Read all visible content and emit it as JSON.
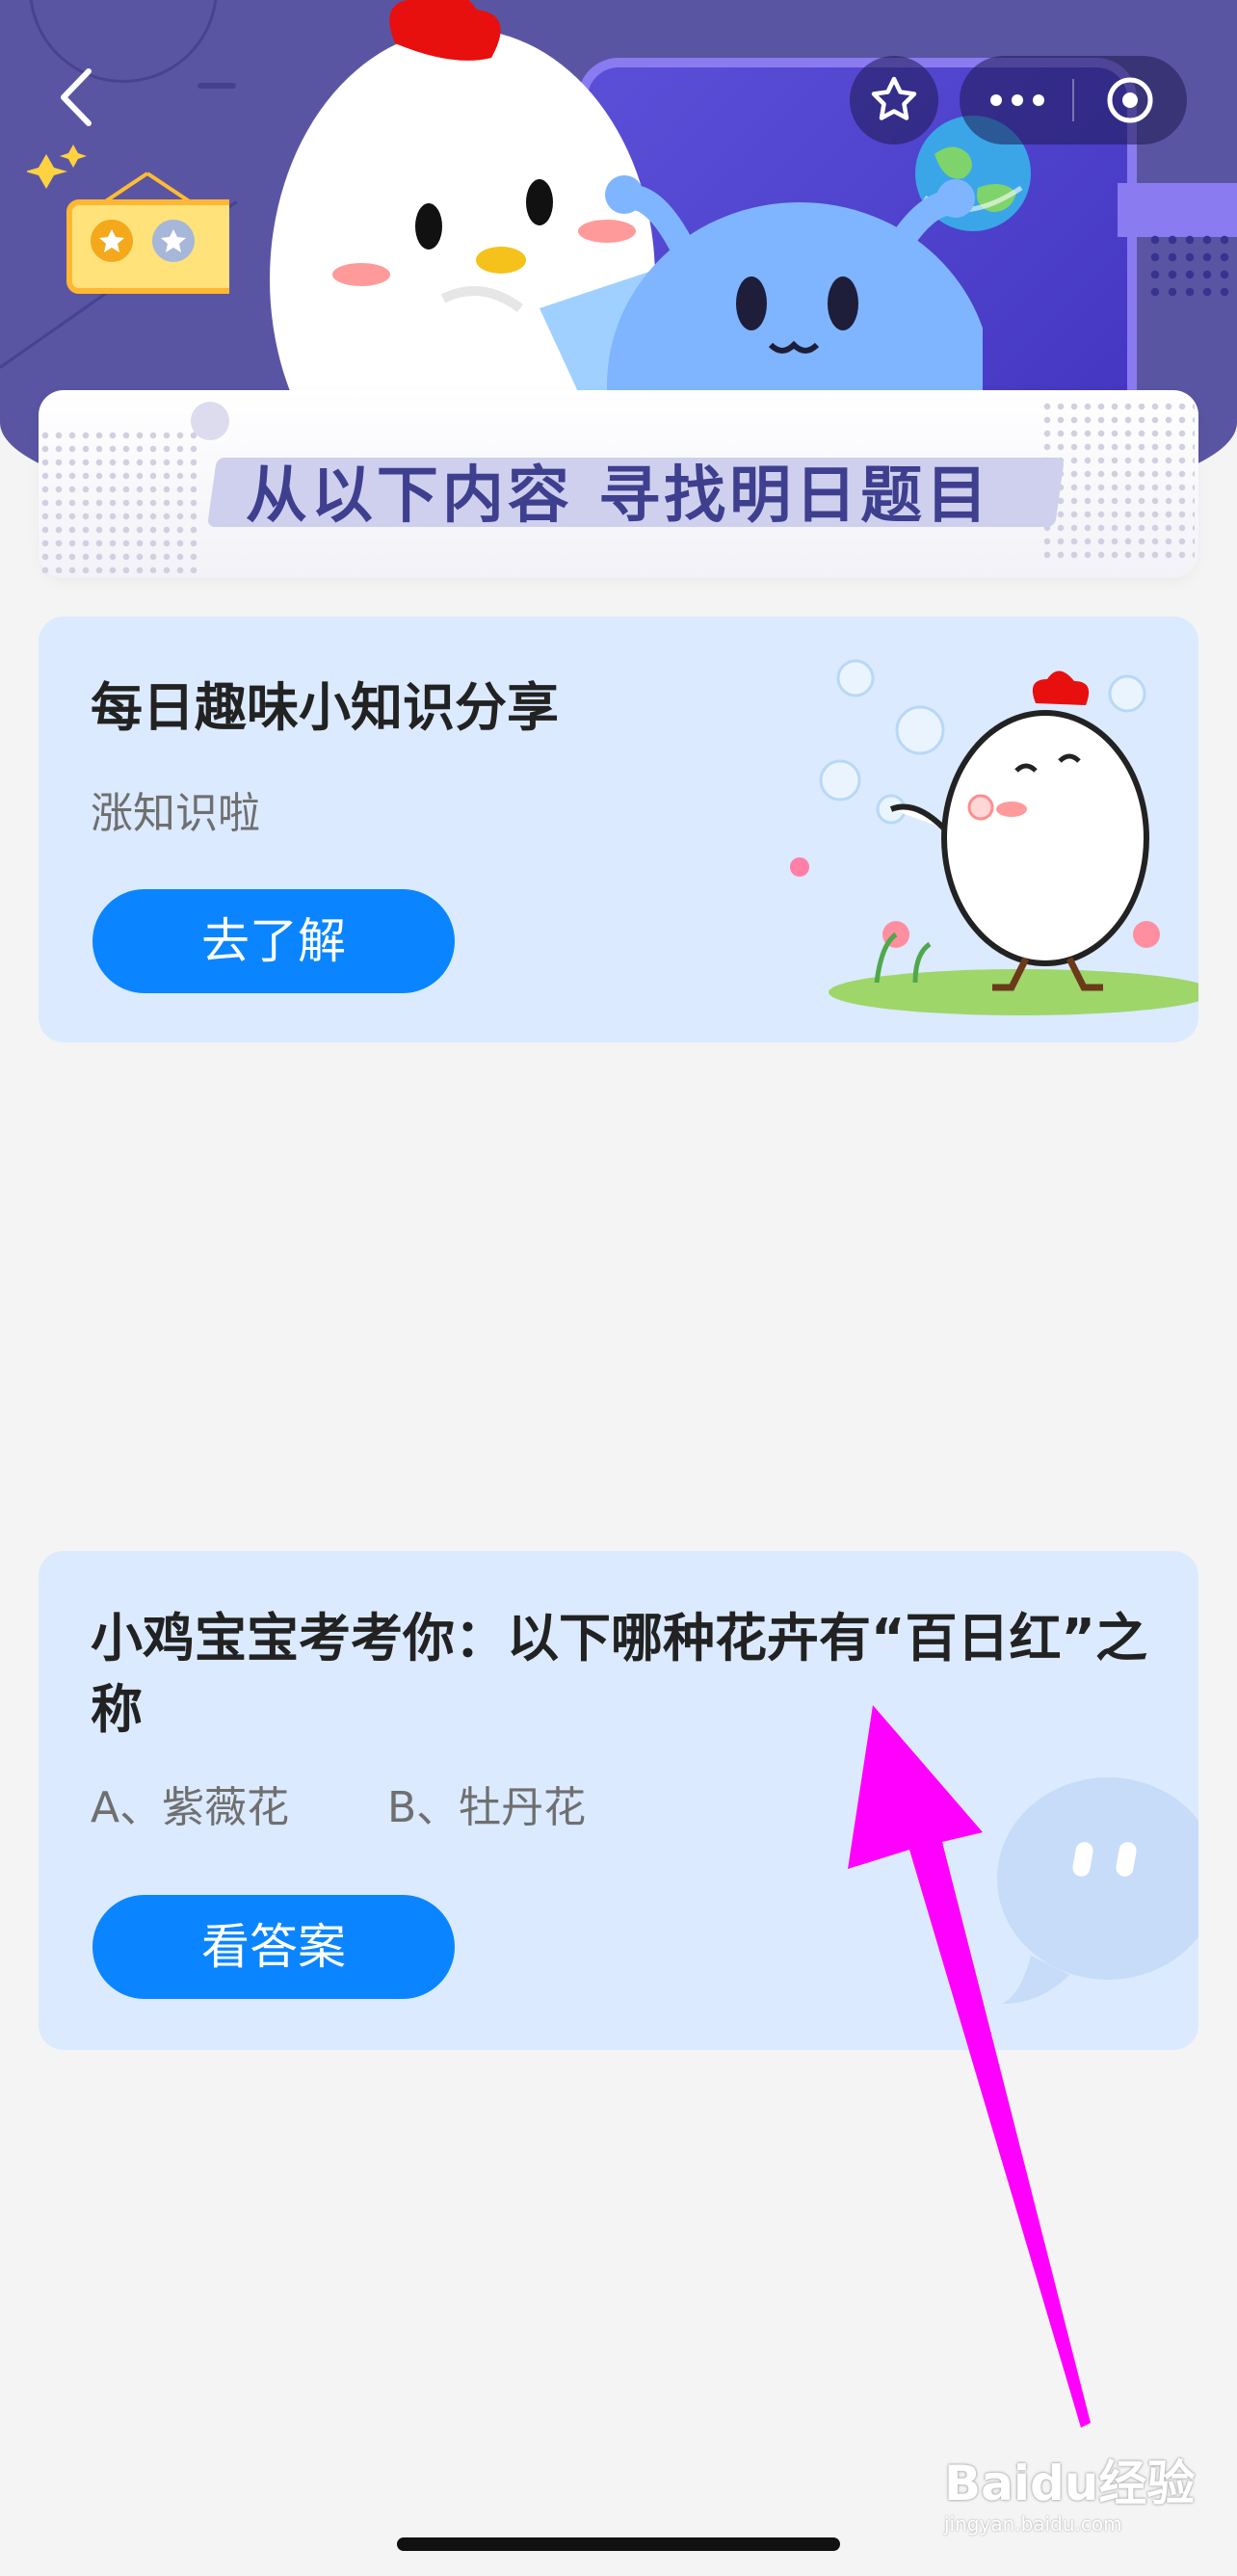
{
  "banner": {
    "title": "从以下内容 寻找明日题目"
  },
  "card1": {
    "title": "每日趣味小知识分享",
    "subtitle": "涨知识啦",
    "button_label": "去了解"
  },
  "card2": {
    "question": "小鸡宝宝考考你：以下哪种花卉有“百日红”之称",
    "option_a": "A、紫薇花",
    "option_b": "B、牡丹花",
    "button_label": "看答案"
  },
  "watermark": {
    "text": "Baidu经验",
    "subtext": "jingyan.baidu.com"
  },
  "icons": [
    "back-icon",
    "star-icon",
    "more-icon",
    "close-icon",
    "medal-icon",
    "earth-icon"
  ],
  "colors": {
    "header": "#5a55a3",
    "card_bg": "#dbeaff",
    "button_blue": "#0a85ff",
    "arrow_magenta": "#ff00ff"
  }
}
